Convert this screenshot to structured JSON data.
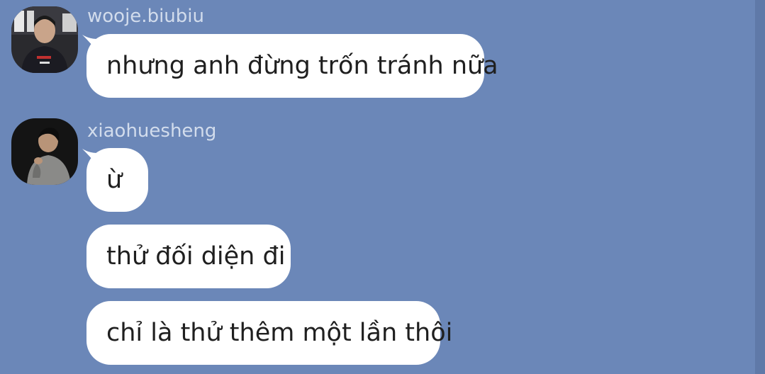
{
  "theme": {
    "background": "#6b87b8",
    "bubble": "#ffffff",
    "sender_text": "#d2dcec",
    "message_text": "#1f1f1f"
  },
  "messages": [
    {
      "sender": "wooje.biubiu",
      "avatar_icon": "user-avatar-icon",
      "texts": [
        "nhưng anh đừng trốn tránh nữa"
      ]
    },
    {
      "sender": "xiaohuesheng",
      "avatar_icon": "user-avatar-icon",
      "texts": [
        "ừ",
        "thử đối diện đi",
        "chỉ là thử thêm một lần thôi"
      ]
    }
  ]
}
